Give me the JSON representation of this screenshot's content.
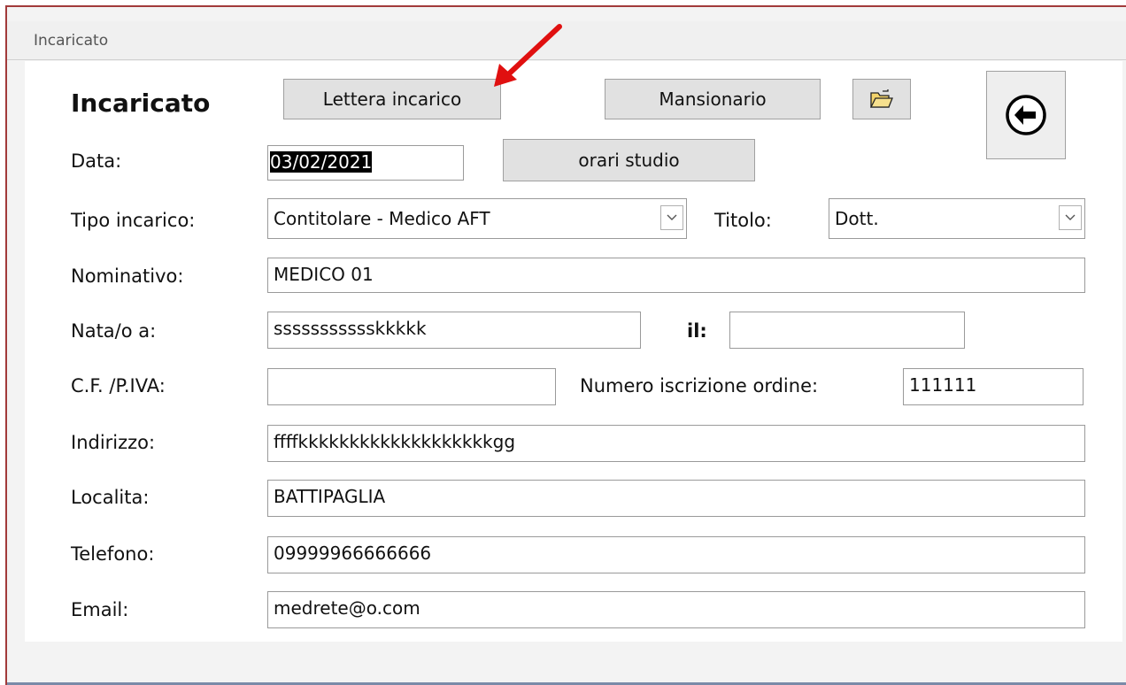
{
  "window": {
    "title": "Incaricato"
  },
  "form": {
    "heading": "Incaricato",
    "buttons": {
      "lettera": "Lettera incarico",
      "mansionario": "Mansionario",
      "orari": "orari studio"
    },
    "labels": {
      "data": "Data:",
      "tipo": "Tipo incarico:",
      "titolo": "Titolo:",
      "nominativo": "Nominativo:",
      "nata": "Nata/o a:",
      "il": "il:",
      "cf": "C.F. /P.IVA:",
      "numero": "Numero iscrizione ordine:",
      "indirizzo": "Indirizzo:",
      "localita": "Localita:",
      "telefono": "Telefono:",
      "email": "Email:"
    },
    "values": {
      "data": "03/02/2021",
      "tipo": "Contitolare - Medico AFT",
      "titolo": "Dott.",
      "nominativo": "MEDICO 01",
      "nata": "ssssssssssskkkkk",
      "il": "",
      "cf": "",
      "numero": "111111",
      "indirizzo": "ffffkkkkkkkkkkkkkkkkkkkgg",
      "localita": "BATTIPAGLIA",
      "telefono": "09999966666666",
      "email": "medrete@o.com"
    }
  },
  "annotation": {
    "arrow_color": "#e01010"
  }
}
